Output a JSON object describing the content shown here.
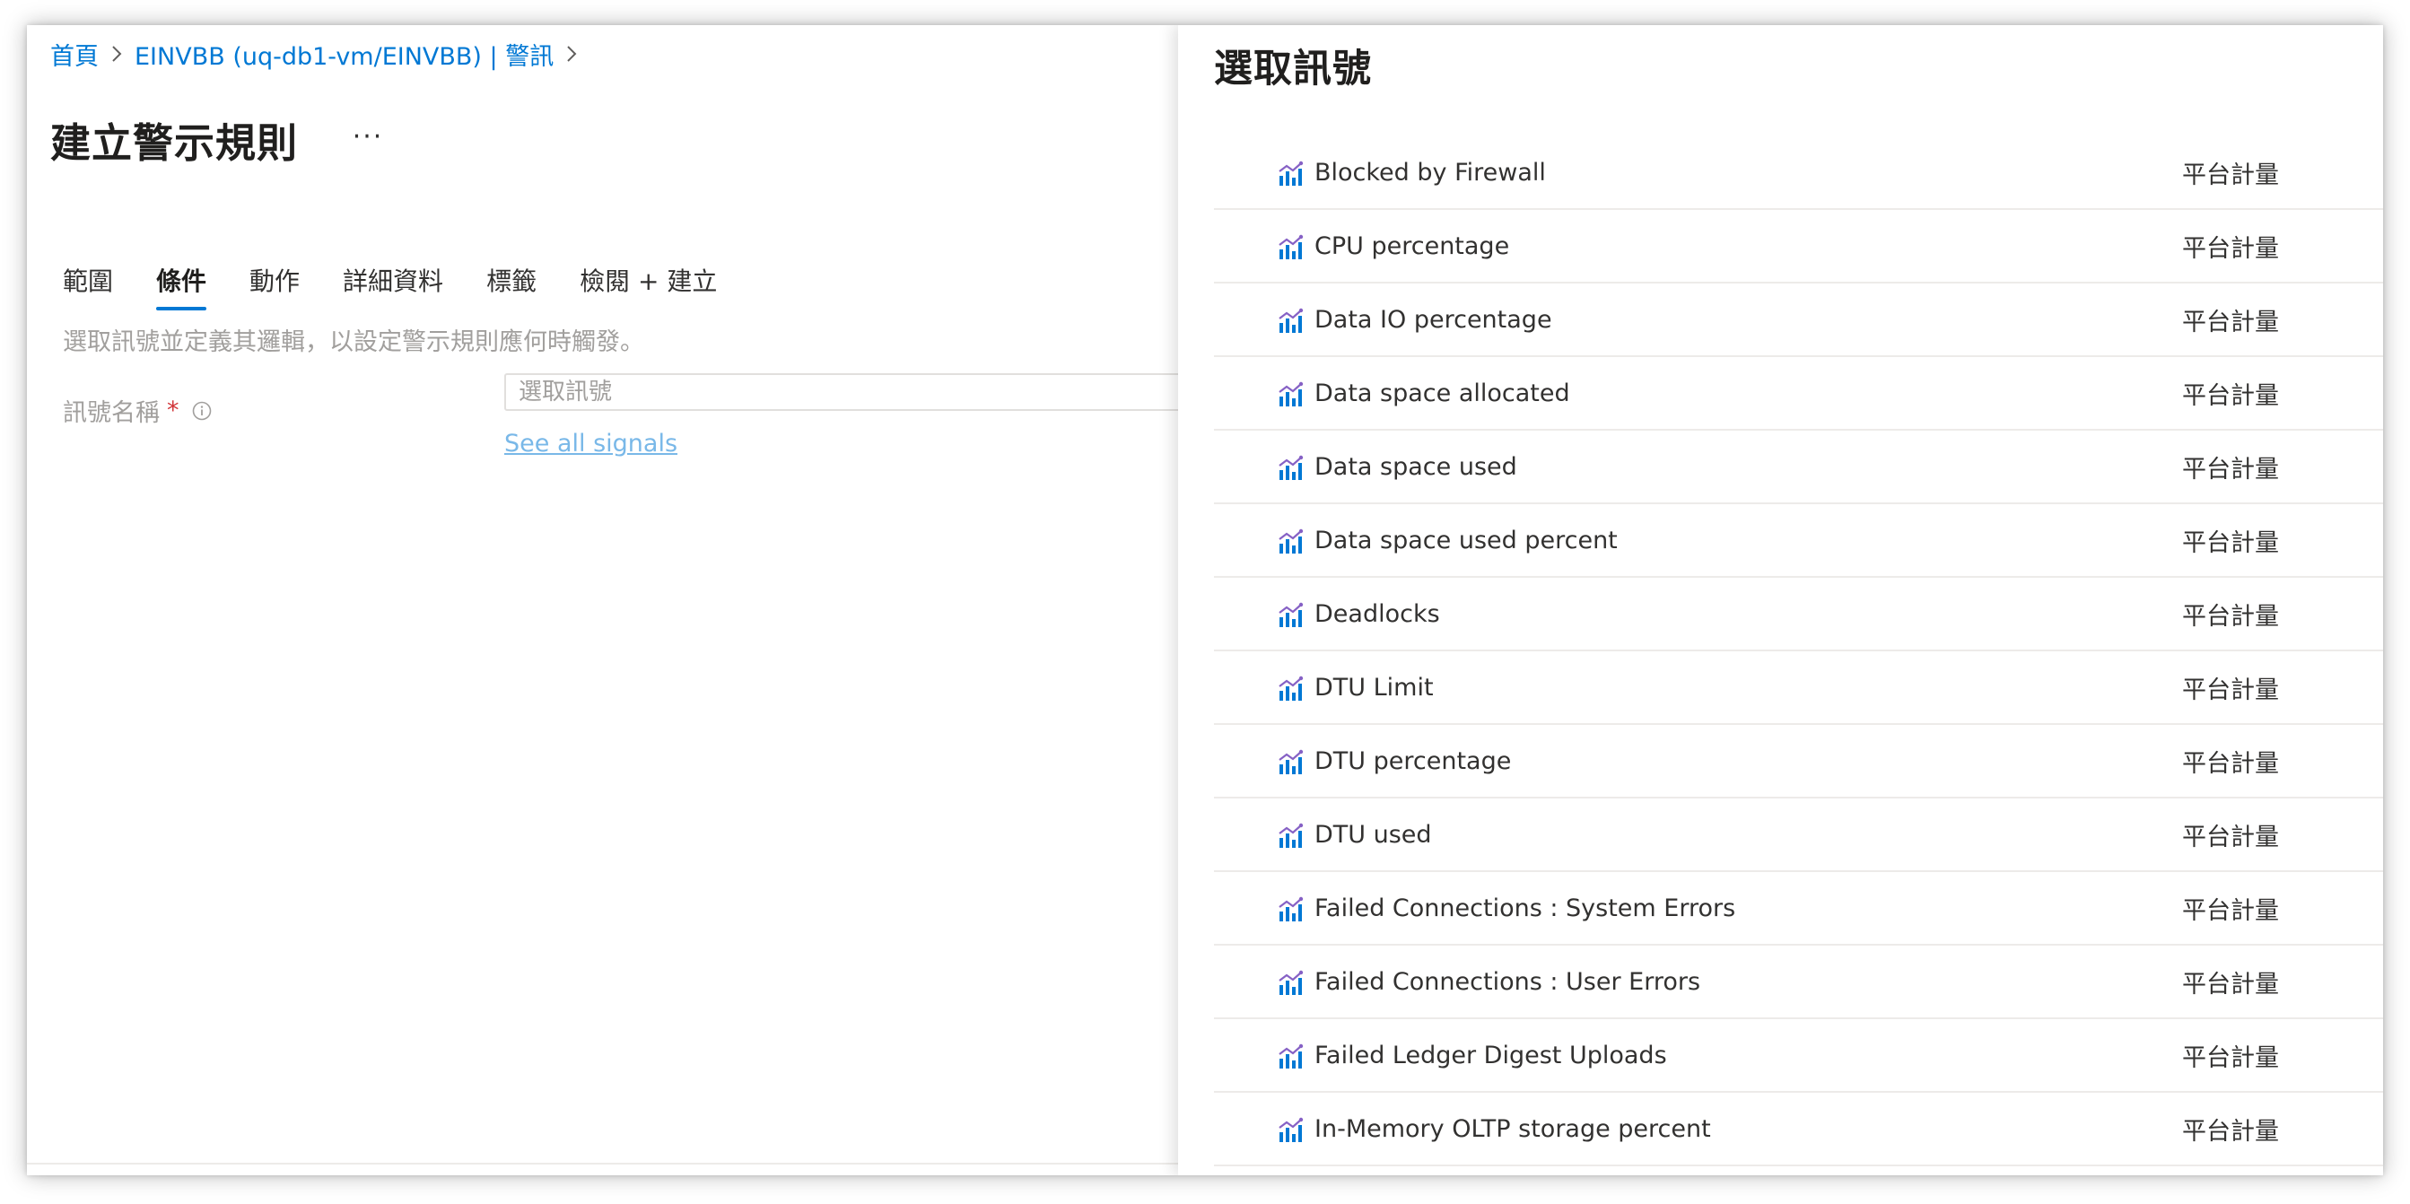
{
  "breadcrumb": {
    "items": [
      "首頁",
      "EINVBB (uq-db1-vm/EINVBB) | 警訊"
    ]
  },
  "page": {
    "title": "建立警示規則",
    "more_label": "···"
  },
  "tabs": [
    {
      "label": "範圍",
      "active": false
    },
    {
      "label": "條件",
      "active": true
    },
    {
      "label": "動作",
      "active": false
    },
    {
      "label": "詳細資料",
      "active": false
    },
    {
      "label": "標籤",
      "active": false
    },
    {
      "label": "檢閱 + 建立",
      "active": false
    }
  ],
  "condition": {
    "description": "選取訊號並定義其邏輯，以設定警示規則應何時觸發。",
    "signal_label": "訊號名稱",
    "required_mark": "*",
    "signal_placeholder": "選取訊號",
    "see_all_link": "See all signals"
  },
  "panel": {
    "title": "選取訊號",
    "signals": [
      {
        "name": "Blocked by Firewall",
        "type": "平台計量"
      },
      {
        "name": "CPU percentage",
        "type": "平台計量"
      },
      {
        "name": "Data IO percentage",
        "type": "平台計量"
      },
      {
        "name": "Data space allocated",
        "type": "平台計量"
      },
      {
        "name": "Data space used",
        "type": "平台計量"
      },
      {
        "name": "Data space used percent",
        "type": "平台計量"
      },
      {
        "name": "Deadlocks",
        "type": "平台計量"
      },
      {
        "name": "DTU Limit",
        "type": "平台計量"
      },
      {
        "name": "DTU percentage",
        "type": "平台計量"
      },
      {
        "name": "DTU used",
        "type": "平台計量"
      },
      {
        "name": "Failed Connections : System Errors",
        "type": "平台計量"
      },
      {
        "name": "Failed Connections : User Errors",
        "type": "平台計量"
      },
      {
        "name": "Failed Ledger Digest Uploads",
        "type": "平台計量"
      },
      {
        "name": "In-Memory OLTP storage percent",
        "type": "平台計量"
      }
    ],
    "signal_icon": "metric-chart-icon"
  },
  "colors": {
    "link": "#0078d4",
    "tab_underline": "#0078d4",
    "required": "#d13438",
    "icon_bar": "#0078d4",
    "icon_line": "#8661c5"
  }
}
